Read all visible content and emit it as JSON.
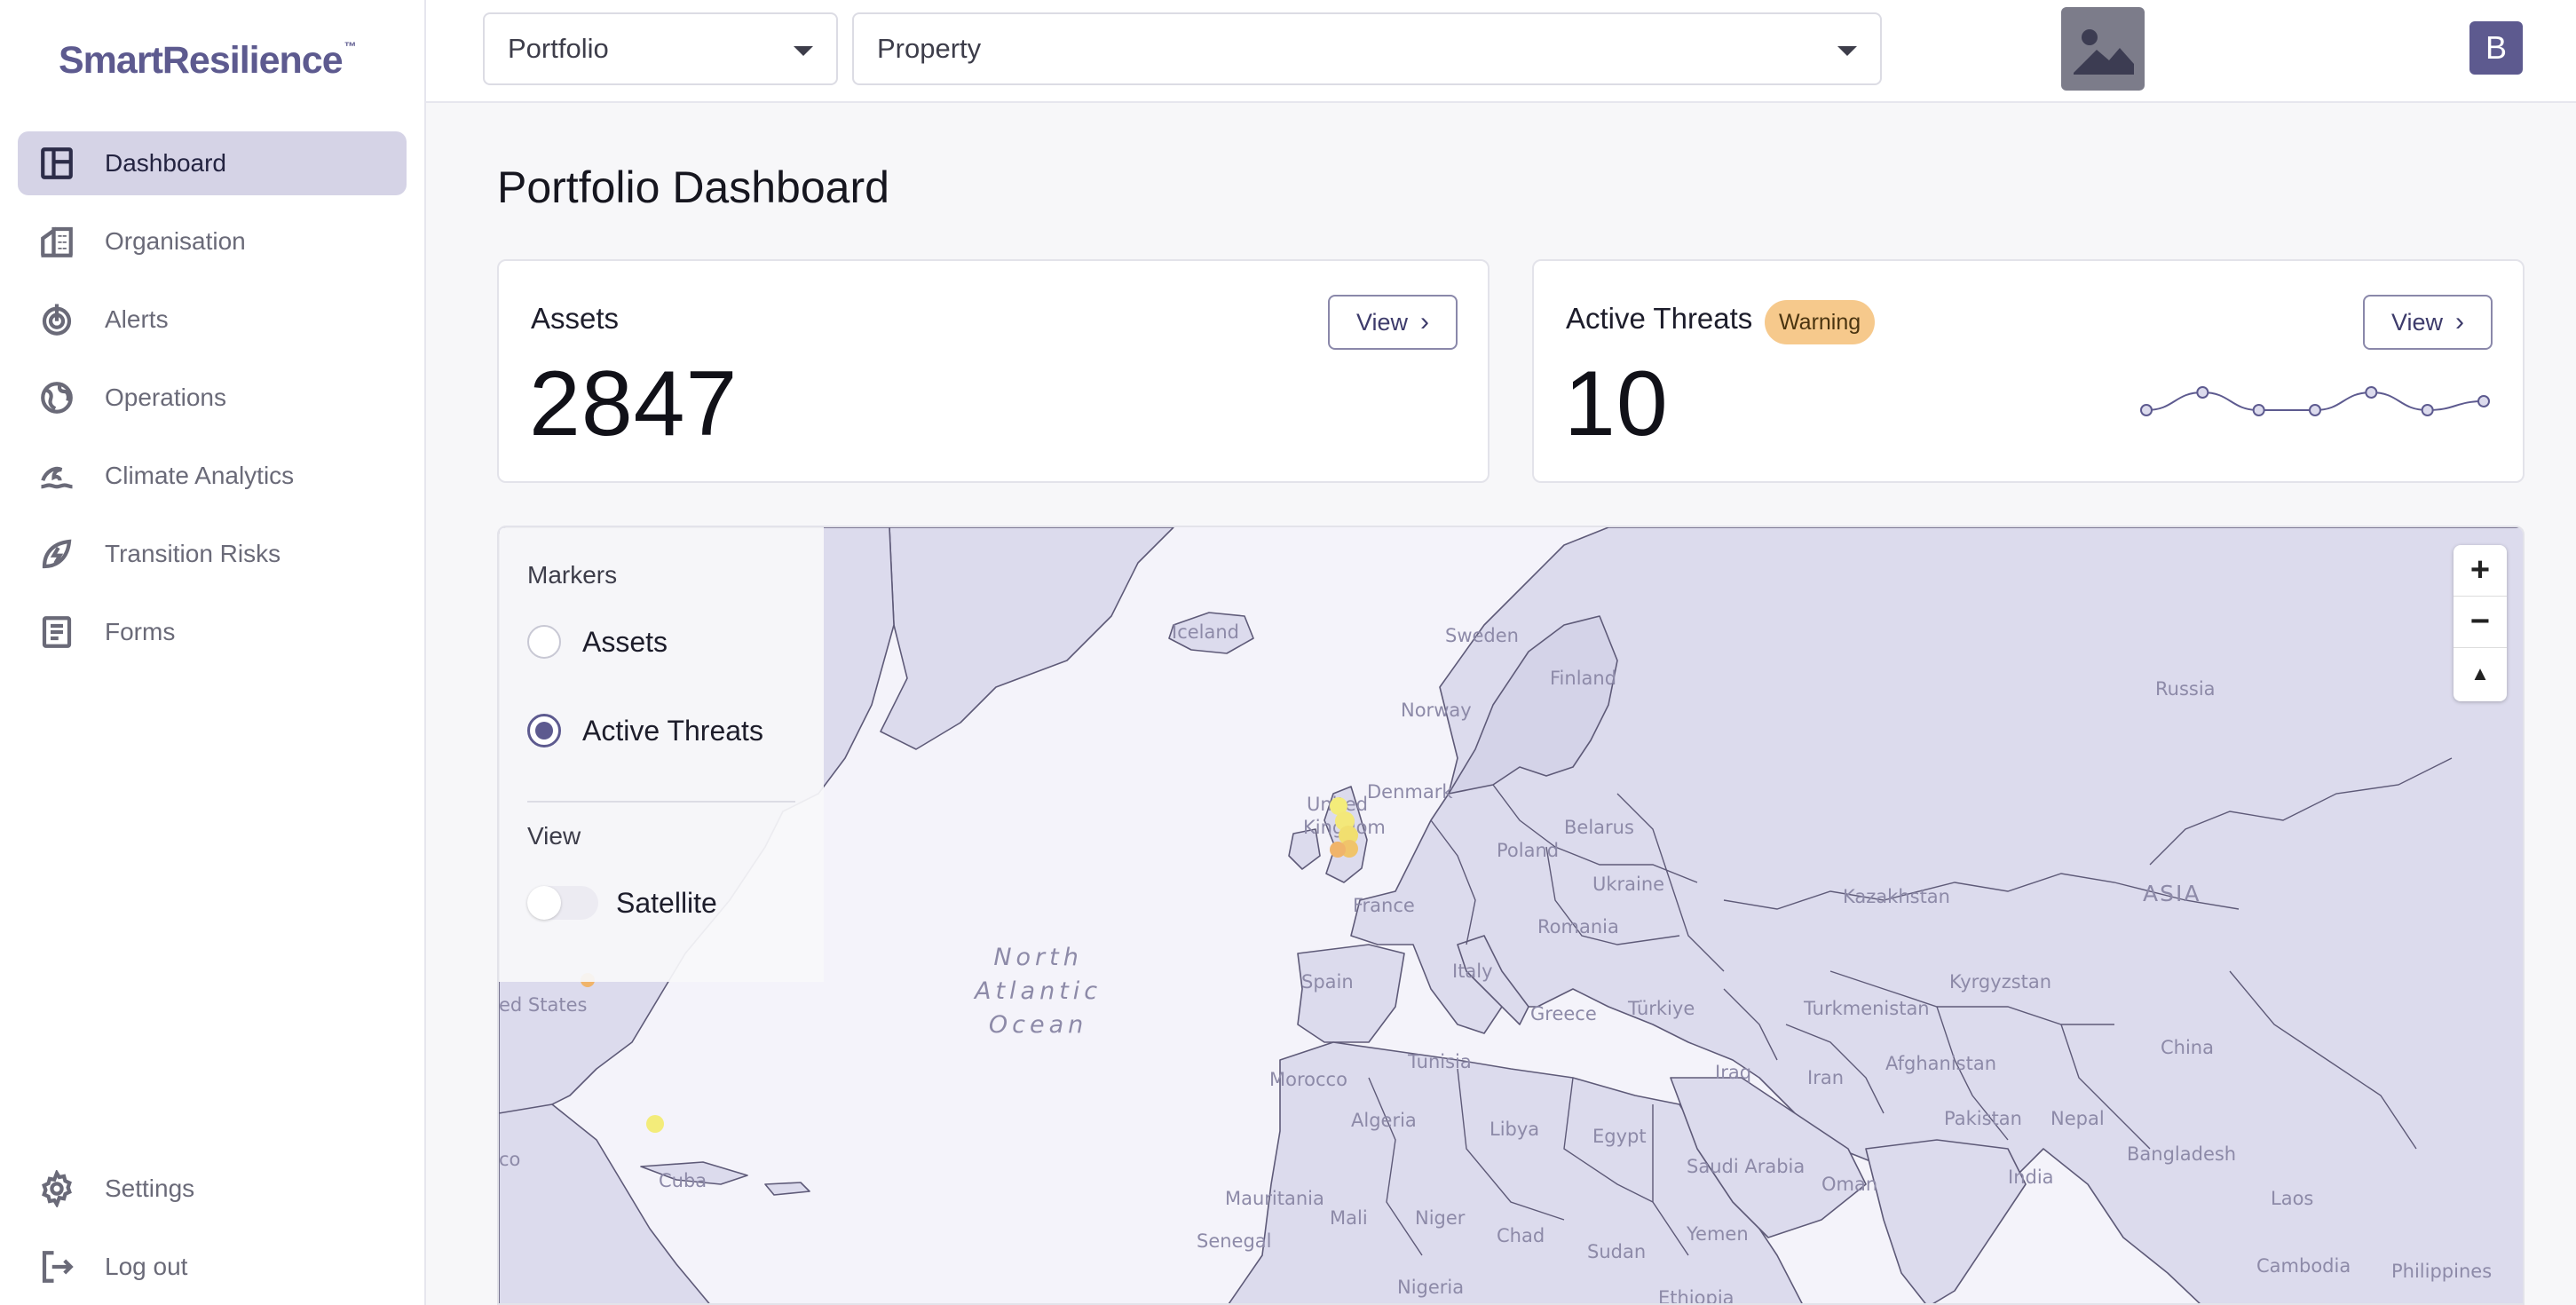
{
  "app": {
    "logo": "SmartResilience",
    "logo_mark": "™"
  },
  "sidebar": {
    "items": [
      {
        "label": "Dashboard",
        "icon": "dashboard-icon",
        "active": true
      },
      {
        "label": "Organisation",
        "icon": "building-icon"
      },
      {
        "label": "Alerts",
        "icon": "alert-radar-icon"
      },
      {
        "label": "Operations",
        "icon": "globe-icon"
      },
      {
        "label": "Climate Analytics",
        "icon": "wave-icon"
      },
      {
        "label": "Transition Risks",
        "icon": "leaf-bolt-icon"
      },
      {
        "label": "Forms",
        "icon": "form-icon"
      }
    ],
    "bottom": [
      {
        "label": "Settings",
        "icon": "gear-icon"
      },
      {
        "label": "Log out",
        "icon": "logout-icon"
      }
    ]
  },
  "topbar": {
    "portfolio_select": "Portfolio",
    "property_select": "Property",
    "avatar_letter": "B"
  },
  "main": {
    "title": "Portfolio Dashboard",
    "assets_card": {
      "title": "Assets",
      "value": "2847",
      "view_label": "View"
    },
    "threats_card": {
      "title": "Active Threats",
      "badge": "Warning",
      "value": "10",
      "view_label": "View",
      "sparkline_values": [
        2,
        4,
        2,
        2,
        4,
        2,
        3
      ]
    }
  },
  "map": {
    "panel": {
      "markers_heading": "Markers",
      "options": [
        "Assets",
        "Active Threats"
      ],
      "selected": "Active Threats",
      "view_heading": "View",
      "satellite_label": "Satellite",
      "satellite_on": false
    },
    "ocean_label": [
      "North",
      "Atlantic",
      "Ocean"
    ],
    "labels": {
      "iceland": "Iceland",
      "sweden": "Sweden",
      "finland": "Finland",
      "norway": "Norway",
      "russia": "Russia",
      "denmark": "Denmark",
      "uk1": "United",
      "uk2": "Kingdom",
      "belarus": "Belarus",
      "poland": "Poland",
      "ukraine": "Ukraine",
      "kazakhstan": "Kazakhstan",
      "asia": "ASIA",
      "france": "France",
      "romania": "Romania",
      "spain": "Spain",
      "italy": "Italy",
      "greece": "Greece",
      "turkiye": "Türkiye",
      "turkmenistan": "Turkmenistan",
      "kyrgyzstan": "Kyrgyzstan",
      "china": "China",
      "us": "ed States",
      "iraq": "Iraq",
      "iran": "Iran",
      "afghanistan": "Afghanistan",
      "morocco": "Morocco",
      "tunisia": "Tunisia",
      "pakistan": "Pakistan",
      "nepal": "Nepal",
      "algeria": "Algeria",
      "libya": "Libya",
      "egypt": "Egypt",
      "saudi": "Saudi Arabia",
      "bangladesh": "Bangladesh",
      "oman": "Oman",
      "india": "India",
      "cuba": "Cuba",
      "mexico": "co",
      "mauritania": "Mauritania",
      "mali": "Mali",
      "niger": "Niger",
      "chad": "Chad",
      "yemen": "Yemen",
      "laos": "Laos",
      "senegal": "Senegal",
      "sudan": "Sudan",
      "nigeria": "Nigeria",
      "ethiopia": "Ethiopia",
      "cambodia": "Cambodia",
      "philippines": "Philippines"
    },
    "zoom": {
      "in": "+",
      "out": "−",
      "reset": "▲"
    }
  },
  "colors": {
    "accent": "#5d5a8f",
    "warning": "#f6c98c",
    "land": "#dcdbed",
    "marker_yellow": "#f3ec7a",
    "marker_orange": "#f0b46a"
  }
}
